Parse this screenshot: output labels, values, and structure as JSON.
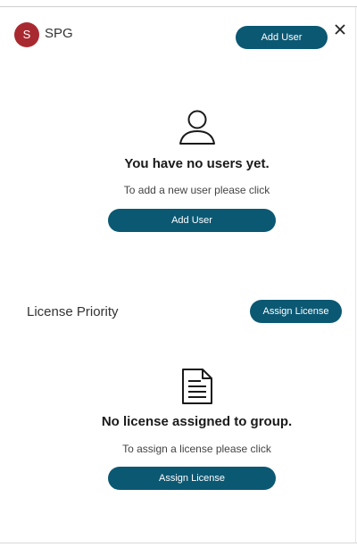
{
  "header": {
    "avatar_letter": "S",
    "group_name": "SPG",
    "add_user_label": "Add User",
    "close_icon": "close-icon"
  },
  "users": {
    "icon": "user-icon",
    "heading": "You have no users yet.",
    "hint": "To add a new user please click",
    "button_label": "Add User"
  },
  "license": {
    "title": "License Priority",
    "assign_top_label": "Assign License",
    "icon": "document-icon",
    "heading": "No license assigned to group.",
    "hint": "To assign a license please click",
    "button_label": "Assign License"
  },
  "colors": {
    "accent": "#0b5873",
    "avatar": "#a82a30"
  }
}
